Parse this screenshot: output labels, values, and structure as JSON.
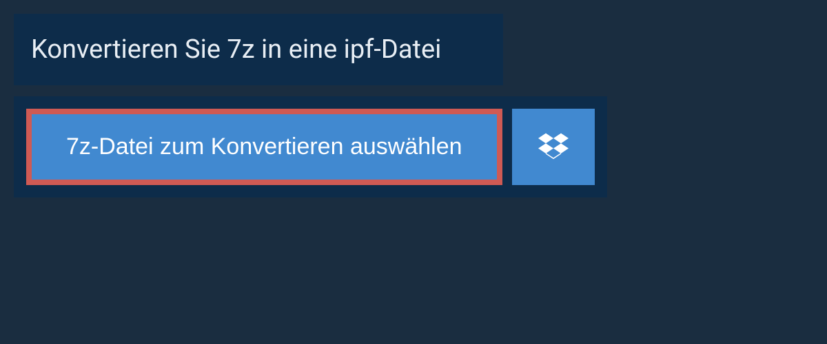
{
  "title": "Konvertieren Sie 7z in eine ipf-Datei",
  "select_button_label": "7z-Datei zum Konvertieren auswählen",
  "colors": {
    "background": "#1a2d40",
    "panel": "#0d2c4a",
    "button": "#4189d0",
    "highlight_border": "#cf5a54",
    "text": "#e8eef4"
  }
}
